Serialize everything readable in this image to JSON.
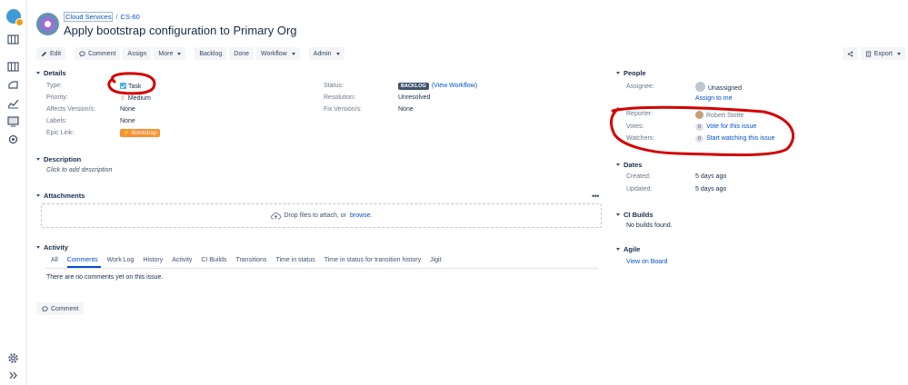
{
  "breadcrumb": {
    "project": "Cloud Services",
    "separator": "/",
    "issue_key": "CS-60"
  },
  "issue": {
    "title": "Apply bootstrap configuration to Primary Org"
  },
  "toolbar": {
    "edit": "Edit",
    "comment": "Comment",
    "assign": "Assign",
    "more": "More",
    "backlog": "Backlog",
    "done": "Done",
    "workflow": "Workflow",
    "admin": "Admin",
    "export": "Export"
  },
  "details": {
    "heading": "Details",
    "type_label": "Type:",
    "type_value": "Task",
    "priority_label": "Priority:",
    "priority_value": "Medium",
    "affects_label": "Affects Version/s:",
    "affects_value": "None",
    "labels_label": "Labels:",
    "labels_value": "None",
    "epic_label": "Epic Link:",
    "epic_value": "Bootstrap",
    "status_label": "Status:",
    "status_value": "BACKLOG",
    "status_link": "(View Workflow)",
    "resolution_label": "Resolution:",
    "resolution_value": "Unresolved",
    "fix_label": "Fix Version/s:",
    "fix_value": "None"
  },
  "description": {
    "heading": "Description",
    "placeholder": "Click to add description"
  },
  "attachments": {
    "heading": "Attachments",
    "drop_text": "Drop files to attach, or",
    "browse": "browse."
  },
  "activity": {
    "heading": "Activity",
    "tabs": [
      "All",
      "Comments",
      "Work Log",
      "History",
      "Activity",
      "CI Builds",
      "Transitions",
      "Time in status",
      "Time in status for transition history",
      "Jigit"
    ],
    "active_tab": "Comments",
    "empty": "There are no comments yet on this issue.",
    "comment_button": "Comment"
  },
  "people": {
    "heading": "People",
    "assignee_label": "Assignee:",
    "assignee_value": "Unassigned",
    "assign_to_me": "Assign to me",
    "reporter_label": "Reporter:",
    "reporter_value": "Robert Stotte",
    "votes_label": "Votes:",
    "votes_count": "0",
    "votes_link": "Vote for this issue",
    "watchers_label": "Watchers:",
    "watchers_count": "0",
    "watchers_link": "Start watching this issue"
  },
  "dates": {
    "heading": "Dates",
    "created_label": "Created:",
    "created_value": "5 days ago",
    "updated_label": "Updated:",
    "updated_value": "5 days ago"
  },
  "ci_builds": {
    "heading": "CI Builds",
    "empty": "No builds found."
  },
  "agile": {
    "heading": "Agile",
    "link": "View on Board"
  },
  "colors": {
    "link": "#0052cc",
    "annotation": "#d40000",
    "epic": "#f79232",
    "task": "#4bade8"
  }
}
